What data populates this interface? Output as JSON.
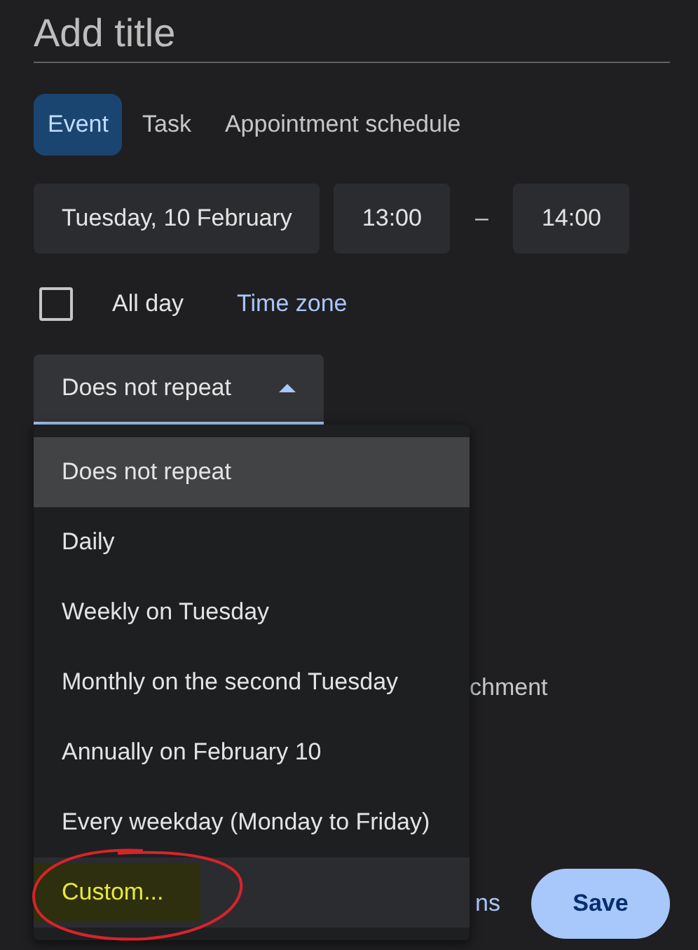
{
  "title_field": {
    "placeholder": "Add title"
  },
  "tabs": [
    {
      "label": "Event",
      "selected": true
    },
    {
      "label": "Task",
      "selected": false
    },
    {
      "label": "Appointment schedule",
      "selected": false
    }
  ],
  "date": "Tuesday, 10 February",
  "start_time": "13:00",
  "separator": "–",
  "end_time": "14:00",
  "all_day": {
    "label": "All day",
    "checked": false
  },
  "time_zone": "Time zone",
  "repeat": {
    "value": "Does not repeat",
    "expanded": true
  },
  "menu_items": [
    {
      "label": "Does not repeat",
      "selected": true,
      "hovered": false,
      "annotated": false
    },
    {
      "label": "Daily",
      "selected": false,
      "hovered": false,
      "annotated": false
    },
    {
      "label": "Weekly on Tuesday",
      "selected": false,
      "hovered": false,
      "annotated": false
    },
    {
      "label": "Monthly on the second Tuesday",
      "selected": false,
      "hovered": false,
      "annotated": false
    },
    {
      "label": "Annually on February 10",
      "selected": false,
      "hovered": false,
      "annotated": false
    },
    {
      "label": "Every weekday (Monday to Friday)",
      "selected": false,
      "hovered": false,
      "annotated": false
    },
    {
      "label": "Custom...",
      "selected": false,
      "hovered": true,
      "annotated": true
    }
  ],
  "covered_text": "chment",
  "covered_link": "ns",
  "save_button": "Save"
}
